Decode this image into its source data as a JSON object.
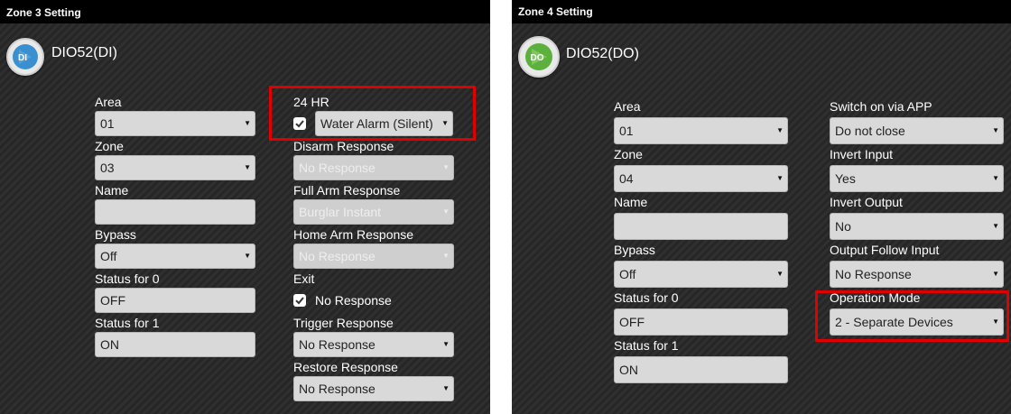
{
  "left_panel": {
    "title": "Zone 3 Setting",
    "device_icon_text": "DI",
    "device_name": "DIO52(DI)",
    "area": {
      "label": "Area",
      "value": "01"
    },
    "zone": {
      "label": "Zone",
      "value": "03"
    },
    "name": {
      "label": "Name",
      "value": ""
    },
    "bypass": {
      "label": "Bypass",
      "value": "Off"
    },
    "status0": {
      "label": "Status for 0",
      "value": "OFF"
    },
    "status1": {
      "label": "Status for 1",
      "value": "ON"
    },
    "hr24": {
      "label": "24 HR",
      "checked": true,
      "value": "Water Alarm (Silent)"
    },
    "disarm": {
      "label": "Disarm Response",
      "value": "No Response",
      "disabled": true
    },
    "full_arm": {
      "label": "Full Arm Response",
      "value": "Burglar Instant",
      "disabled": true
    },
    "home_arm": {
      "label": "Home Arm Response",
      "value": "No Response",
      "disabled": true
    },
    "exit": {
      "label": "Exit",
      "checked": true,
      "value": "No Response"
    },
    "trigger": {
      "label": "Trigger Response",
      "value": "No Response"
    },
    "restore": {
      "label": "Restore Response",
      "value": "No Response"
    }
  },
  "right_panel": {
    "title": "Zone 4 Setting",
    "device_icon_text": "DO",
    "device_name": "DIO52(DO)",
    "area": {
      "label": "Area",
      "value": "01"
    },
    "zone": {
      "label": "Zone",
      "value": "04"
    },
    "name": {
      "label": "Name",
      "value": ""
    },
    "bypass": {
      "label": "Bypass",
      "value": "Off"
    },
    "status0": {
      "label": "Status for 0",
      "value": "OFF"
    },
    "status1": {
      "label": "Status for 1",
      "value": "ON"
    },
    "switch_app": {
      "label": "Switch on via APP",
      "value": "Do not close"
    },
    "invert_input": {
      "label": "Invert Input",
      "value": "Yes"
    },
    "invert_output": {
      "label": "Invert Output",
      "value": "No"
    },
    "output_follow": {
      "label": "Output Follow Input",
      "value": "No Response"
    },
    "operation_mode": {
      "label": "Operation Mode",
      "value": "2 - Separate Devices"
    }
  },
  "colors": {
    "highlight": "#e00000",
    "di_icon": "#3a8fd0",
    "do_icon": "#5cb03c"
  },
  "icons": {
    "select_caret": "caret-down-icon",
    "checkbox": "checkmark-icon"
  }
}
